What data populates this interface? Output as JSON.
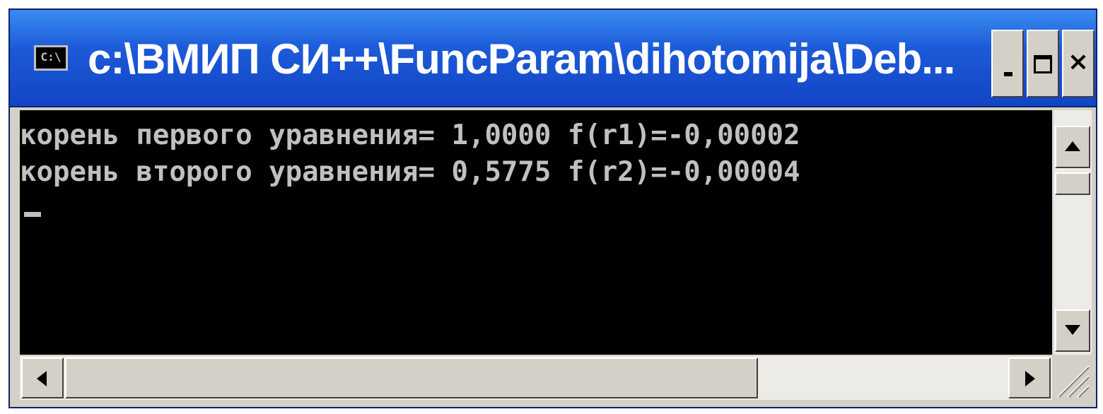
{
  "window": {
    "title": "c:\\ВМИП СИ++\\FuncParam\\dihotomija\\Deb...",
    "icon": "console-icon",
    "icon_text": "C:\\"
  },
  "title_buttons": {
    "minimize_icon": "minimize-icon",
    "maximize_icon": "maximize-icon",
    "close_icon": "close-icon",
    "close_glyph": "×"
  },
  "console": {
    "lines": [
      "корень первого уравнения= 1,0000 f(r1)=-0,00002",
      "корень второго уравнения= 0,5775 f(r2)=-0,00004"
    ],
    "background": "#000000",
    "text_color": "#c0c0c0"
  },
  "colors": {
    "titlebar": "#1c5ad8",
    "frame": "#d4d0c8"
  }
}
